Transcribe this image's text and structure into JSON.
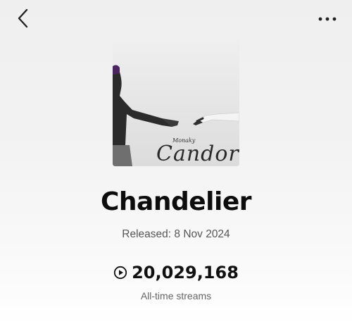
{
  "header": {
    "back_icon": "chevron-left-icon",
    "more_icon": "more-horizontal-icon"
  },
  "cover": {
    "artist_text": "Monaky",
    "album_text": "Candor"
  },
  "track": {
    "title": "Chandelier",
    "released": "Released: 8 Nov 2024"
  },
  "stats": {
    "play_icon": "play-circle-icon",
    "streams_count": "20,029,168",
    "streams_label": "All-time streams"
  }
}
